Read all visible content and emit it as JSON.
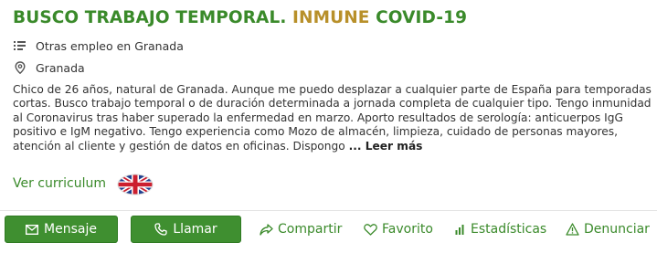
{
  "ad": {
    "title_part1": "BUSCO TRABAJO TEMPORAL.",
    "title_highlight": "INMUNE",
    "title_part2": "COVID-19",
    "category": "Otras empleo en Granada",
    "location": "Granada",
    "description": "Chico de 26 años, natural de Granada. Aunque me puedo desplazar a cualquier parte de España para temporadas cortas. Busco trabajo temporal o de duración determinada a jornada completa de cualquier tipo. Tengo inmunidad al Coronavirus tras haber superado la enfermedad en marzo. Aporto resultados de serología: anticuerpos IgG positivo e IgM negativo. Tengo experiencia como Mozo de almacén, limpieza, cuidado de personas mayores, atención al cliente y gestión de datos en oficinas. Dispongo",
    "read_more": "... Leer más",
    "cv_link": "Ver curriculum",
    "flag_icon": "uk-flag-icon"
  },
  "actions": {
    "message": "Mensaje",
    "call": "Llamar",
    "share": "Compartir",
    "favorite": "Favorito",
    "stats": "Estadísticas",
    "report": "Denunciar"
  },
  "colors": {
    "primary_green": "#3a8a2a",
    "button_green": "#3f8f30",
    "highlight_gold": "#b8902a"
  }
}
